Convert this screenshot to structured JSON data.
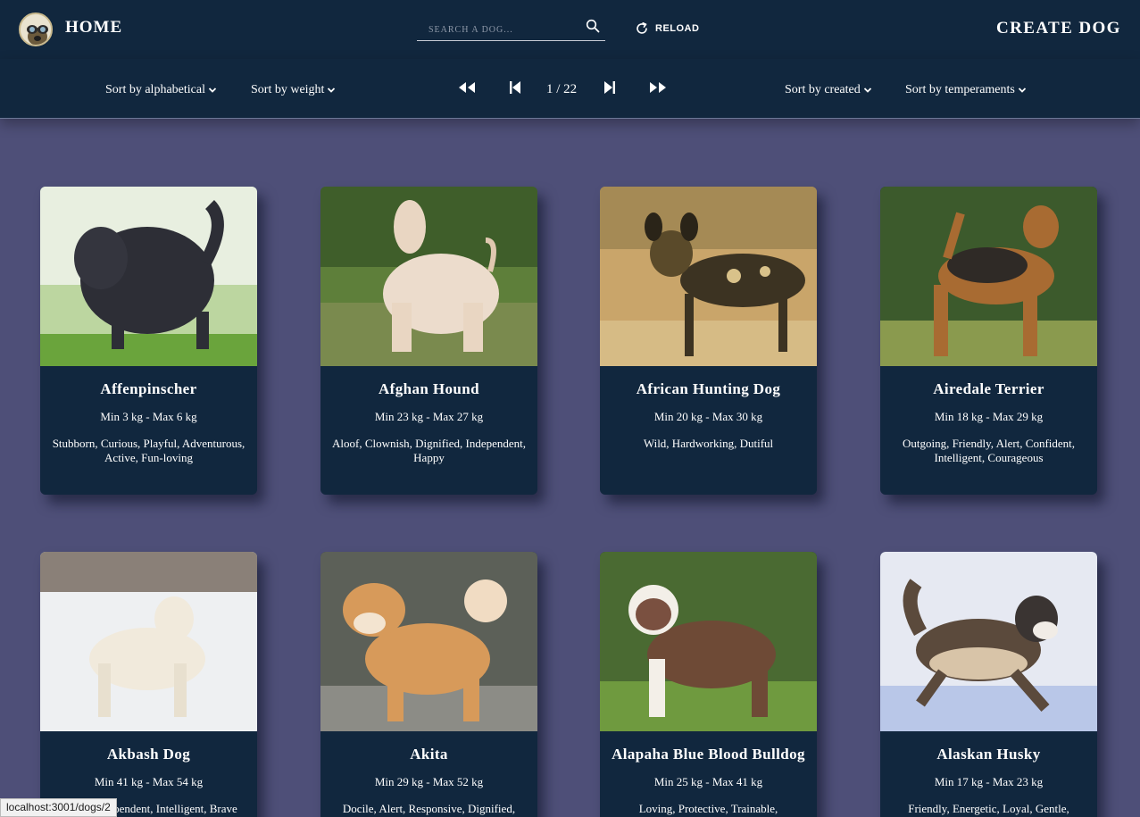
{
  "nav": {
    "home_label": "HOME",
    "search_placeholder": "SEARCH A DOG...",
    "reload_label": "RELOAD",
    "create_label": "CREATE DOG"
  },
  "filters": {
    "alphabetical": "Sort by alphabetical",
    "weight": "Sort by weight",
    "created": "Sort by created",
    "temperaments": "Sort by temperaments"
  },
  "pagination": {
    "label": "1 / 22",
    "current_page": 1,
    "total_pages": 22
  },
  "dogs": [
    {
      "name": "Affenpinscher",
      "weight": "Min 3 kg - Max 6 kg",
      "temperaments": "Stubborn, Curious, Playful, Adventurous, Active, Fun-loving"
    },
    {
      "name": "Afghan Hound",
      "weight": "Min 23 kg - Max 27 kg",
      "temperaments": "Aloof, Clownish, Dignified, Independent, Happy"
    },
    {
      "name": "African Hunting Dog",
      "weight": "Min 20 kg - Max 30 kg",
      "temperaments": "Wild, Hardworking, Dutiful"
    },
    {
      "name": "Airedale Terrier",
      "weight": "Min 18 kg - Max 29 kg",
      "temperaments": "Outgoing, Friendly, Alert, Confident, Intelligent, Courageous"
    },
    {
      "name": "Akbash Dog",
      "weight": "Min 41 kg - Max 54 kg",
      "temperaments": "Loyal, Independent, Intelligent, Brave"
    },
    {
      "name": "Akita",
      "weight": "Min 29 kg - Max 52 kg",
      "temperaments": "Docile, Alert, Responsive, Dignified,"
    },
    {
      "name": "Alapaha Blue Blood Bulldog",
      "weight": "Min 25 kg - Max 41 kg",
      "temperaments": "Loving, Protective, Trainable,"
    },
    {
      "name": "Alaskan Husky",
      "weight": "Min 17 kg - Max 23 kg",
      "temperaments": "Friendly, Energetic, Loyal, Gentle,"
    }
  ],
  "status_bar": {
    "url": "localhost:3001/dogs/2"
  },
  "colors": {
    "background": "#4e4f78",
    "navbar": "#11273e",
    "card": "#11273e",
    "text": "#ffffff"
  }
}
